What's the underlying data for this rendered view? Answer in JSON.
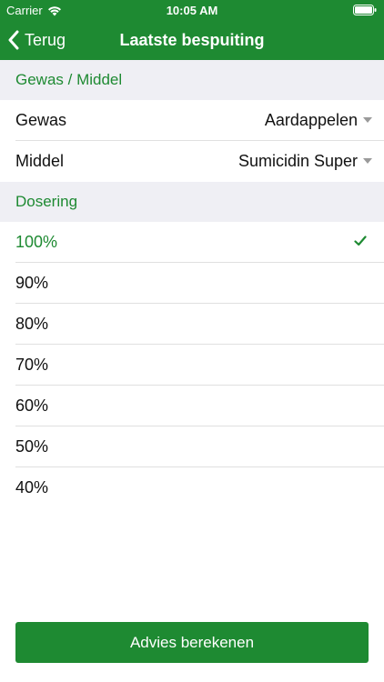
{
  "status_bar": {
    "carrier": "Carrier",
    "time": "10:05 AM",
    "wifi_icon": "wifi-icon",
    "battery_icon": "battery-icon"
  },
  "nav": {
    "back_label": "Terug",
    "back_icon": "chevron-left-icon",
    "title": "Laatste bespuiting"
  },
  "colors": {
    "brand_green": "#1e8a32",
    "section_bg": "#efeff4"
  },
  "section_crop": {
    "header": "Gewas / Middel",
    "rows": [
      {
        "label": "Gewas",
        "value": "Aardappelen",
        "icon": "caret-down-icon"
      },
      {
        "label": "Middel",
        "value": "Sumicidin Super",
        "icon": "caret-down-icon"
      }
    ]
  },
  "section_dosage": {
    "header": "Dosering",
    "options": [
      {
        "label": "100%",
        "selected": true,
        "icon": "checkmark-icon"
      },
      {
        "label": "90%",
        "selected": false
      },
      {
        "label": "80%",
        "selected": false
      },
      {
        "label": "70%",
        "selected": false
      },
      {
        "label": "60%",
        "selected": false
      },
      {
        "label": "50%",
        "selected": false
      },
      {
        "label": "40%",
        "selected": false
      }
    ]
  },
  "actions": {
    "calculate_label": "Advies berekenen"
  }
}
